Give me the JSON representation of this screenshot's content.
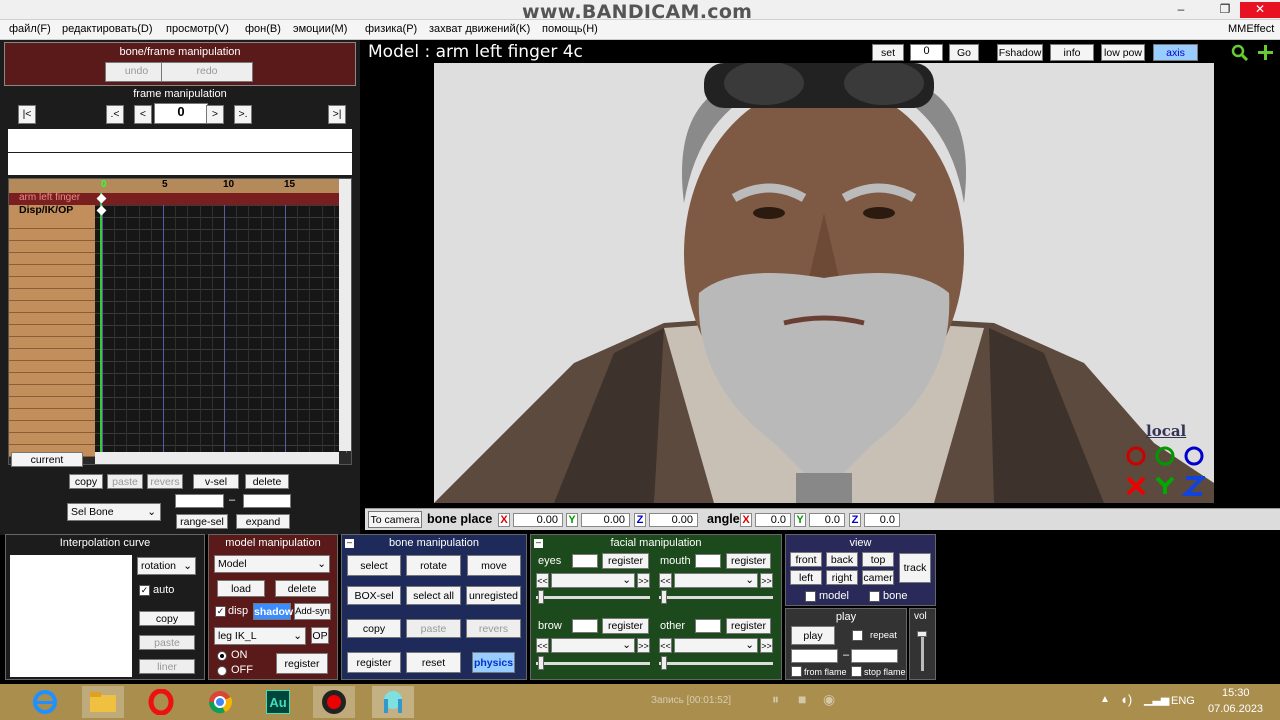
{
  "window": {
    "watermark": "www.BANDICAM.com",
    "min": "–",
    "max": "❐",
    "close": "✕"
  },
  "menu": [
    "файл(F)",
    "редактировать(D)",
    "просмотр(V)",
    "фон(B)",
    "эмоции(M)",
    "физика(P)",
    "захват движений(K)",
    "помощь(H)"
  ],
  "menu_right": "MMEffect",
  "bone_frame": {
    "title": "bone/frame manipulation",
    "undo": "undo",
    "redo": "redo"
  },
  "frame_manip": {
    "title": "frame manipulation",
    "first": "|<",
    "prev_key": ".<",
    "prev": "<",
    "frame": "0",
    "next": ">",
    "next_key": ">.",
    "last": ">|"
  },
  "timeline": {
    "ticks": [
      "0",
      "5",
      "10",
      "15"
    ],
    "row1": "arm left finger",
    "row2": "Disp/IK/OP"
  },
  "left_controls": {
    "current": "current",
    "copy": "copy",
    "paste": "paste",
    "revers": "revers",
    "vsel": "v-sel",
    "delete": "delete",
    "sel_bone": "Sel Bone",
    "dash": "–",
    "range_sel": "range-sel",
    "expand": "expand"
  },
  "viewport": {
    "title": "Model : arm left finger 4c",
    "set": "set",
    "set_val": "0",
    "go": "Go",
    "fshadow": "Fshadow",
    "info": "info",
    "low_pow": "low pow",
    "axis": "axis",
    "local": "local"
  },
  "placebar": {
    "to_camera": "To camera",
    "bone_place": "bone place",
    "angle": "angle",
    "x": "X",
    "y": "Y",
    "z": "Z",
    "px": "0.00",
    "py": "0.00",
    "pz": "0.00",
    "ax": "0.0",
    "ay": "0.0",
    "az": "0.0"
  },
  "interp": {
    "title": "Interpolation curve",
    "rotation": "rotation",
    "auto": "auto",
    "copy": "copy",
    "paste": "paste",
    "liner": "liner"
  },
  "model_manip": {
    "title": "model manipulation",
    "model": "Model",
    "load": "load",
    "delete": "delete",
    "disp": "disp",
    "shadow": "shadow",
    "add_syn": "Add-syn",
    "leg": "leg IK_L",
    "op": "OP",
    "on": "ON",
    "off": "OFF",
    "register": "register"
  },
  "bone_manip": {
    "title": "bone manipulation",
    "select": "select",
    "rotate": "rotate",
    "move": "move",
    "box_sel": "BOX-sel",
    "select_all": "select all",
    "unregisted": "unregisted",
    "copy": "copy",
    "paste": "paste",
    "revers": "revers",
    "register": "register",
    "reset": "reset",
    "physics": "physics"
  },
  "facial": {
    "title": "facial manipulation",
    "eyes": "eyes",
    "mouth": "mouth",
    "brow": "brow",
    "other": "other",
    "register": "register",
    "ll": "<<",
    "rr": ">>"
  },
  "view": {
    "title": "view",
    "front": "front",
    "back": "back",
    "top": "top",
    "left": "left",
    "right": "right",
    "camera": "camer",
    "track": "track",
    "model": "model",
    "bone": "bone"
  },
  "play": {
    "title": "play",
    "play": "play",
    "repeat": "repeat",
    "dash": "–",
    "from_flame": "from flame",
    "stop_flame": "stop flame",
    "vol": "vol"
  },
  "taskbar": {
    "recording": "Запись [00:01:52]",
    "lang": "ENG",
    "time": "15:30",
    "date": "07.06.2023"
  },
  "colors": {
    "accent_red": "#5a1a1a",
    "model_panel": "#5a1a1a",
    "bone_panel": "#1d2a5a",
    "facial_panel": "#1d4a1d",
    "view_panel": "#2a2a5a",
    "taskbar": "#a98e4e"
  }
}
